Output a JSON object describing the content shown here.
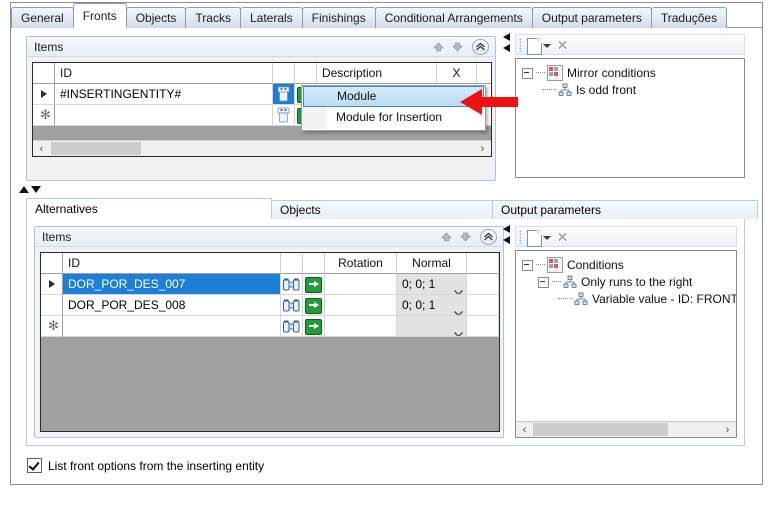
{
  "window": {
    "tabs": [
      {
        "label": "General",
        "active": false
      },
      {
        "label": "Fronts",
        "active": true
      },
      {
        "label": "Objects",
        "active": false
      },
      {
        "label": "Tracks",
        "active": false
      },
      {
        "label": "Laterals",
        "active": false
      },
      {
        "label": "Finishings",
        "active": false
      },
      {
        "label": "Conditional Arrangements",
        "active": false
      },
      {
        "label": "Output parameters",
        "active": false
      },
      {
        "label": "Traduções",
        "active": false
      }
    ]
  },
  "top_section": {
    "items_panel": {
      "title": "Items",
      "buttons": {
        "move_up": "move-up",
        "move_down": "move-down",
        "collapse": "collapse"
      },
      "grid": {
        "columns": [
          "",
          "ID",
          "",
          "",
          "Description",
          "X",
          ""
        ],
        "rows": [
          {
            "indicator": "current",
            "id": "#INSERTINGENTITY#",
            "description": "",
            "x": ""
          },
          {
            "indicator": "new",
            "id": "",
            "description": "",
            "x": ""
          }
        ]
      },
      "hscroll": {
        "left_arrow": "‹",
        "right_arrow": "›"
      }
    },
    "context_menu": {
      "items": [
        {
          "label": "Module",
          "highlighted": true
        },
        {
          "label": "Module for Insertion",
          "highlighted": false
        }
      ]
    },
    "right_panel": {
      "toolbar": {
        "new_label": "new-document",
        "delete_label": "delete"
      },
      "tree": [
        {
          "label": "Mirror conditions",
          "level": 0,
          "icon": "conditions-icon",
          "expanded": true
        },
        {
          "label": "Is odd front",
          "level": 1,
          "icon": "node-icon",
          "expanded": false
        }
      ]
    }
  },
  "splitter": {
    "up_arrow": "▲",
    "down_arrow": "▼"
  },
  "bottom_section": {
    "tabs": [
      {
        "label": "Alternatives",
        "active": true
      },
      {
        "label": "Objects",
        "active": false
      },
      {
        "label": "Output parameters",
        "active": false
      }
    ],
    "items_panel": {
      "title": "Items",
      "grid": {
        "columns": [
          "",
          "ID",
          "",
          "",
          "Rotation",
          "Normal",
          ""
        ],
        "rows": [
          {
            "indicator": "current",
            "id": "DOR_POR_DES_007",
            "selected": true,
            "rotation": "",
            "normal": "0; 0; 1"
          },
          {
            "indicator": "",
            "id": "DOR_POR_DES_008",
            "selected": false,
            "rotation": "",
            "normal": "0; 0; 1"
          },
          {
            "indicator": "new",
            "id": "",
            "selected": false,
            "rotation": "",
            "normal": ""
          }
        ]
      }
    },
    "right_panel": {
      "toolbar": {
        "new_label": "new-document",
        "delete_label": "delete"
      },
      "tree": [
        {
          "label": "Conditions",
          "level": 0,
          "icon": "conditions-icon",
          "expanded": true
        },
        {
          "label": "Only runs to the right",
          "level": 1,
          "icon": "node-icon",
          "expanded": true
        },
        {
          "label": "Variable value - ID: FRONTN",
          "level": 2,
          "icon": "node-icon",
          "expanded": false
        }
      ],
      "hscroll": {
        "left_arrow": "‹",
        "right_arrow": "›"
      }
    }
  },
  "footer": {
    "checkbox": {
      "label": "List front options from the inserting entity",
      "checked": true
    }
  },
  "colors": {
    "selection_blue": "#1d7fd6",
    "annotation_red": "#ee1111",
    "tab_border": "#8a9bb0",
    "panel_border": "#b6cbe4"
  }
}
